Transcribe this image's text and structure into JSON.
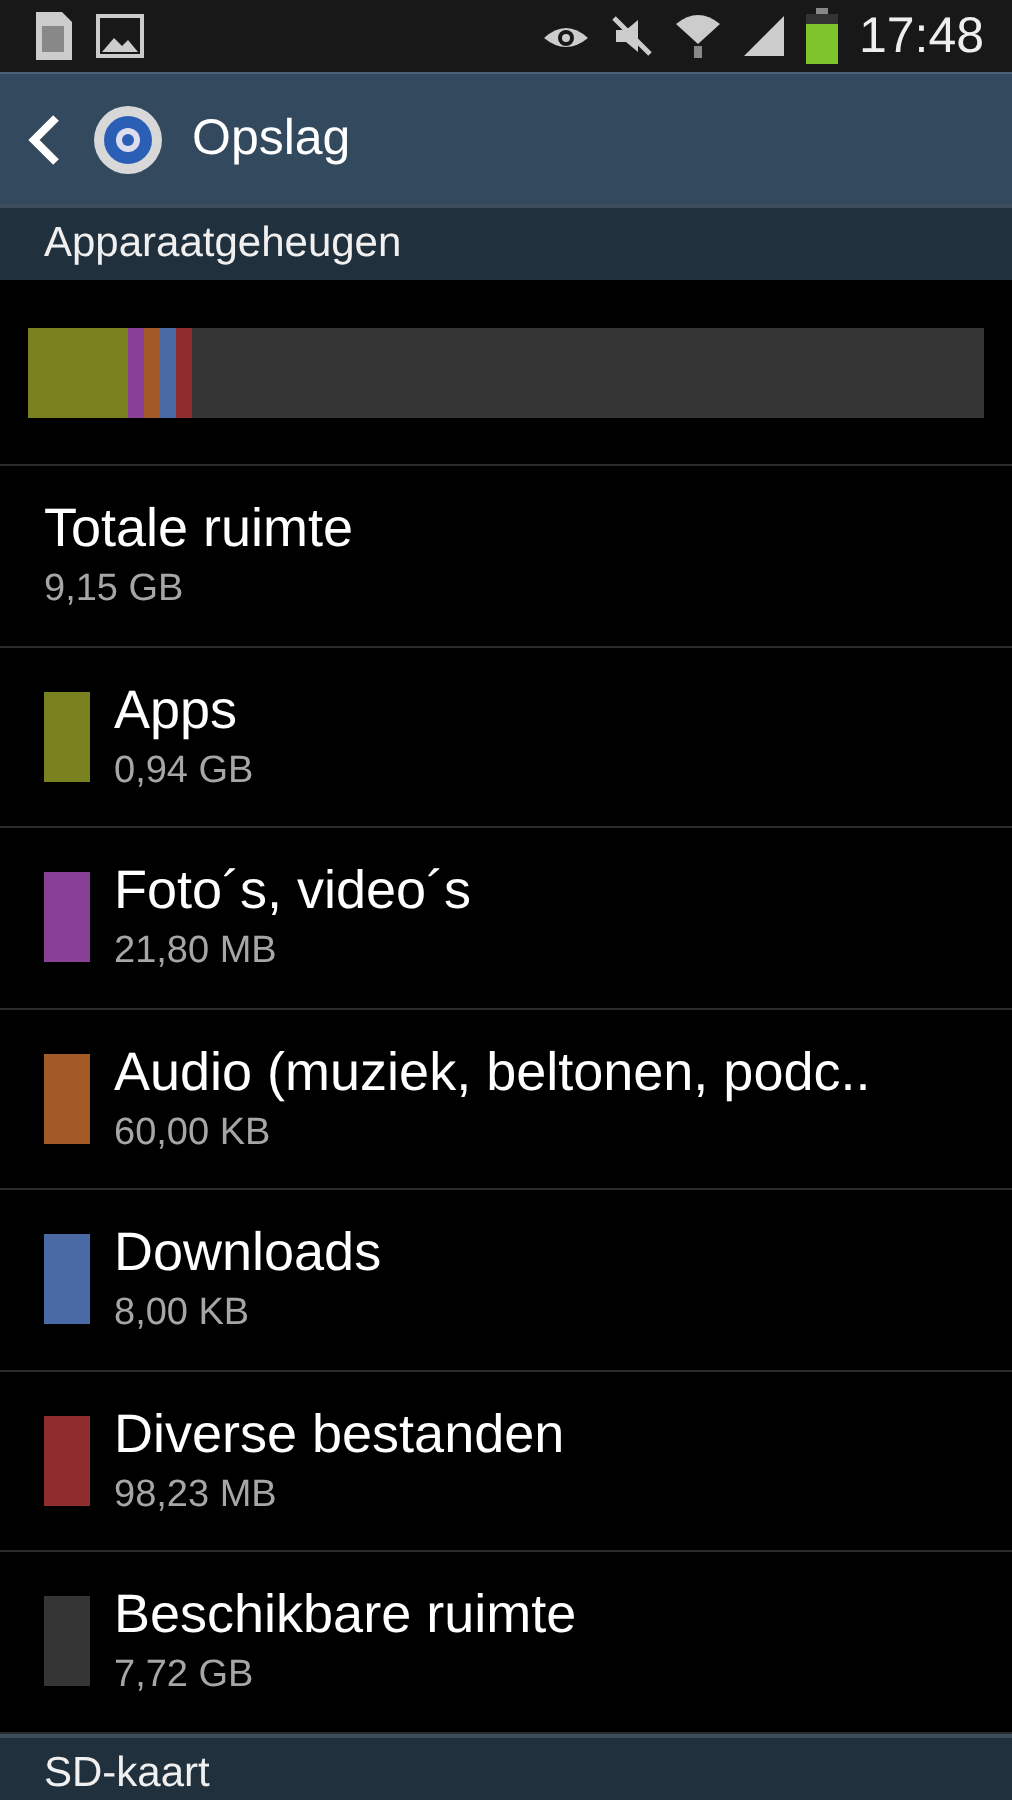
{
  "status_bar": {
    "time": "17:48"
  },
  "app_bar": {
    "title": "Opslag"
  },
  "sections": [
    {
      "title": "Apparaatgeheugen",
      "total": {
        "label": "Totale ruimte",
        "value": "9,15 GB"
      },
      "categories": [
        {
          "label": "Apps",
          "value": "0,94 GB",
          "color": "#7a8220"
        },
        {
          "label": "Foto´s, video´s",
          "value": "21,80 MB",
          "color": "#8a3f96"
        },
        {
          "label": "Audio (muziek, beltonen, podc..",
          "value": "60,00 KB",
          "color": "#a35a26"
        },
        {
          "label": "Downloads",
          "value": "8,00 KB",
          "color": "#4a6aa6"
        },
        {
          "label": "Diverse bestanden",
          "value": "98,23 MB",
          "color": "#8e2c2e"
        },
        {
          "label": "Beschikbare ruimte",
          "value": "7,72 GB",
          "color": "#353535"
        }
      ]
    },
    {
      "title": "SD-kaart"
    }
  ]
}
